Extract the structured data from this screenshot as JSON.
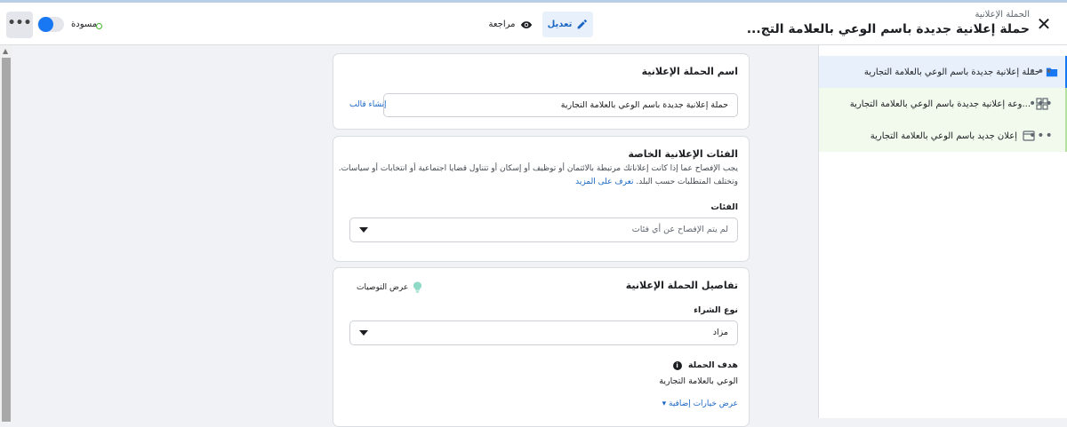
{
  "header": {
    "breadcrumb": "الحملة الإعلانية",
    "title": "حملة إعلانية جديدة باسم الوعي بالعلامة التج...",
    "edit_label": "تعديل",
    "review_label": "مراجعة",
    "draft_label": "مسودة",
    "more_label": "•••",
    "close_label": "✕"
  },
  "tree": {
    "items": [
      {
        "label": "حملة إعلانية جديدة باسم الوعي بالعلامة التجارية",
        "icon": "folder-icon"
      },
      {
        "label": "...وعة إعلانية جديدة باسم الوعي بالعلامة التجارية",
        "icon": "grid-icon"
      },
      {
        "label": "إعلان جديد باسم الوعي بالعلامة التجارية",
        "icon": "ad-icon"
      }
    ],
    "more_label": "•••"
  },
  "campaign_name": {
    "title": "اسم الحملة الإعلانية",
    "value": "حملة إعلانية جديدة باسم الوعي بالعلامة التجارية",
    "create_template": "إنشاء قالب"
  },
  "special_categories": {
    "title": "الفئات الإعلانية الخاصة",
    "desc_line1": "يجب الإفصاح عما إذا كانت إعلاناتك مرتبطة بالائتمان أو توظيف أو إسكان أو تتناول قضايا اجتماعية أو انتخابات أو سياسات.",
    "desc_line2": "وتختلف المتطلبات حسب البلد.",
    "learn_more": "تعرف على المزيد",
    "categories_label": "الفئات",
    "categories_value": "لم يتم الإفصاح عن أي فئات"
  },
  "campaign_details": {
    "title": "تفاصيل الحملة الإعلانية",
    "show_recommendations": "عرض التوصيات",
    "buying_type_label": "نوع الشراء",
    "buying_type_value": "مزاد",
    "objective_label": "هدف الحملة",
    "objective_value": "الوعي بالعلامة التجارية",
    "more_options": "عرض خيارات إضافية ▾"
  },
  "colors": {
    "accent": "#1877f2",
    "link": "#1a66c4",
    "draft_status": "#42b72a"
  }
}
